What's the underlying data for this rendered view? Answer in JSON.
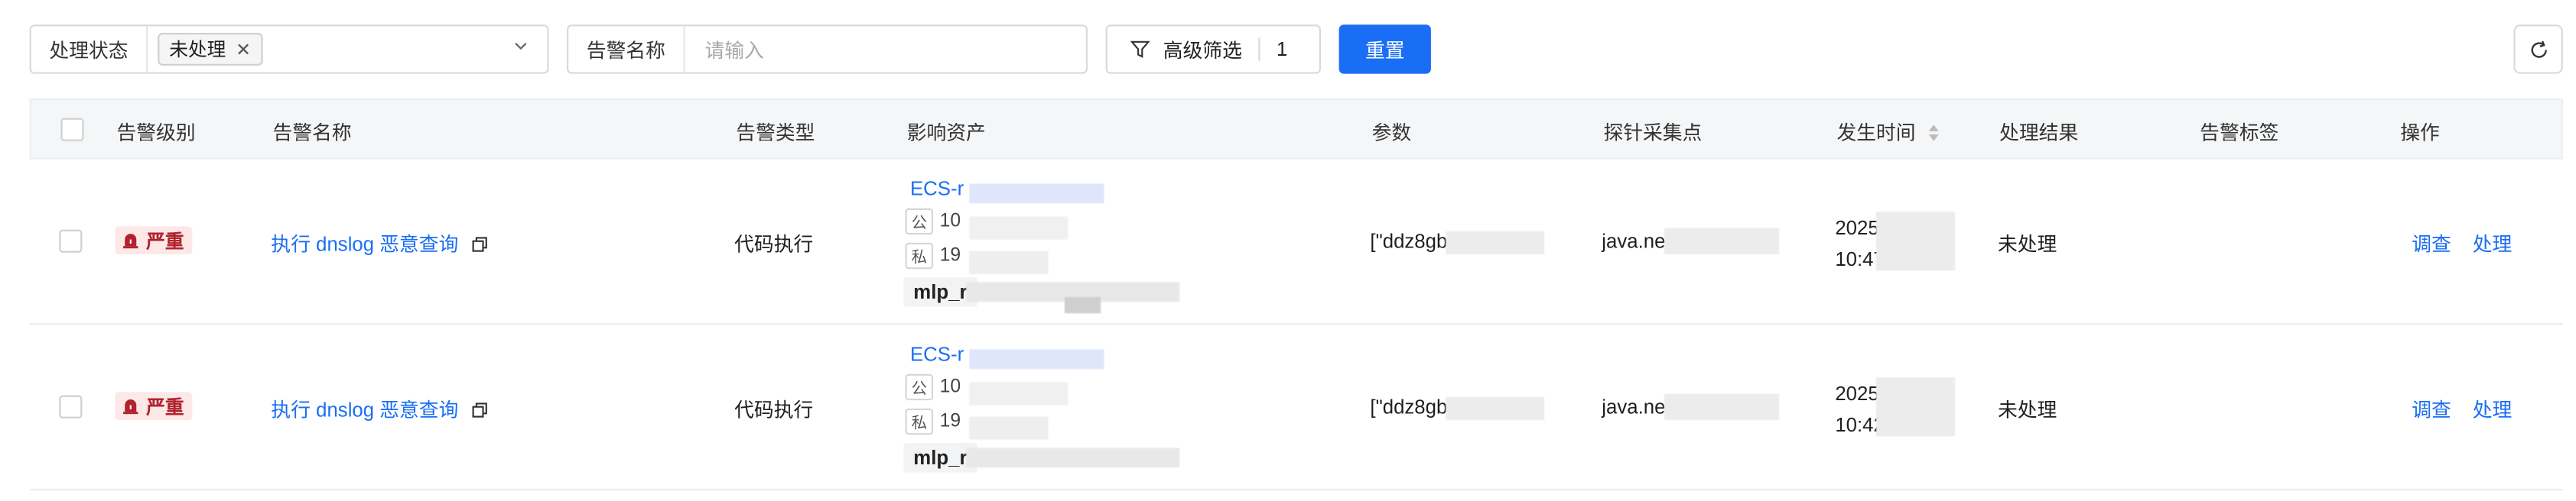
{
  "filters": {
    "status_label": "处理状态",
    "status_tag": "未处理",
    "name_label": "告警名称",
    "name_placeholder": "请输入",
    "advanced_label": "高级筛选",
    "advanced_count": "1",
    "reset_label": "重置"
  },
  "table": {
    "columns": [
      "告警级别",
      "告警名称",
      "告警类型",
      "影响资产",
      "参数",
      "探针采集点",
      "发生时间",
      "处理结果",
      "告警标签",
      "操作"
    ],
    "rows": [
      {
        "severity": "严重",
        "name": "执行 dnslog 恶意查询",
        "type": "代码执行",
        "asset_name": "ECS-r",
        "public_badge": "公",
        "public_ip": "10",
        "private_badge": "私",
        "private_ip": "19",
        "asset_tag": "mlp_r",
        "params": "[\"ddz8gb",
        "probe": "java.ne",
        "time_line1": "2025",
        "time_line2": "10:47",
        "result": "未处理",
        "action_investigate": "调查",
        "action_handle": "处理"
      },
      {
        "severity": "严重",
        "name": "执行 dnslog 恶意查询",
        "type": "代码执行",
        "asset_name": "ECS-r",
        "public_badge": "公",
        "public_ip": "10",
        "private_badge": "私",
        "private_ip": "19",
        "asset_tag": "mlp_r",
        "params": "[\"ddz8gb",
        "probe": "java.ne",
        "time_line1": "2025",
        "time_line2": "10:42",
        "result": "未处理",
        "action_investigate": "调查",
        "action_handle": "处理"
      }
    ]
  },
  "colors": {
    "primary": "#1a6ef5",
    "severity_bg": "#fde8e8",
    "severity_text": "#b0232e",
    "header_bg": "#f5f6f7"
  }
}
